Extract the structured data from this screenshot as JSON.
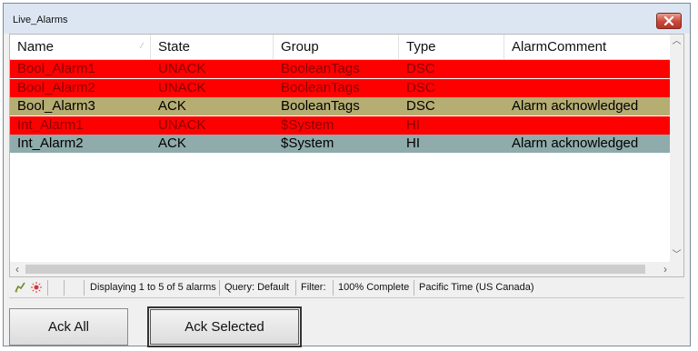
{
  "window": {
    "title": "Live_Alarms",
    "close_icon": "close-icon"
  },
  "columns": [
    "Name",
    "State",
    "Group",
    "Type",
    "AlarmComment"
  ],
  "rows": [
    {
      "name": "Bool_Alarm1",
      "state": "UNACK",
      "group": "BooleanTags",
      "type": "DSC",
      "comment": "",
      "bg": "#ff0000",
      "fg": "#8b0000"
    },
    {
      "name": "Bool_Alarm2",
      "state": "UNACK",
      "group": "BooleanTags",
      "type": "DSC",
      "comment": "",
      "bg": "#ff0000",
      "fg": "#8b0000"
    },
    {
      "name": "Bool_Alarm3",
      "state": "ACK",
      "group": "BooleanTags",
      "type": "DSC",
      "comment": "Alarm acknowledged",
      "bg": "#b5ad72",
      "fg": "#000000"
    },
    {
      "name": "Int_Alarm1",
      "state": "UNACK",
      "group": "$System",
      "type": "HI",
      "comment": "",
      "bg": "#ff0000",
      "fg": "#8b0000"
    },
    {
      "name": "Int_Alarm2",
      "state": "ACK",
      "group": "$System",
      "type": "HI",
      "comment": "Alarm acknowledged",
      "bg": "#8fabab",
      "fg": "#000000"
    }
  ],
  "statusbar": {
    "displaying": "Displaying 1 to 5 of 5 alarms",
    "query": "Query: Default",
    "filter": "Filter:",
    "progress": "100% Complete",
    "timezone": "Pacific Time (US  Canada)"
  },
  "buttons": {
    "ack_all": "Ack All",
    "ack_selected": "Ack Selected"
  }
}
